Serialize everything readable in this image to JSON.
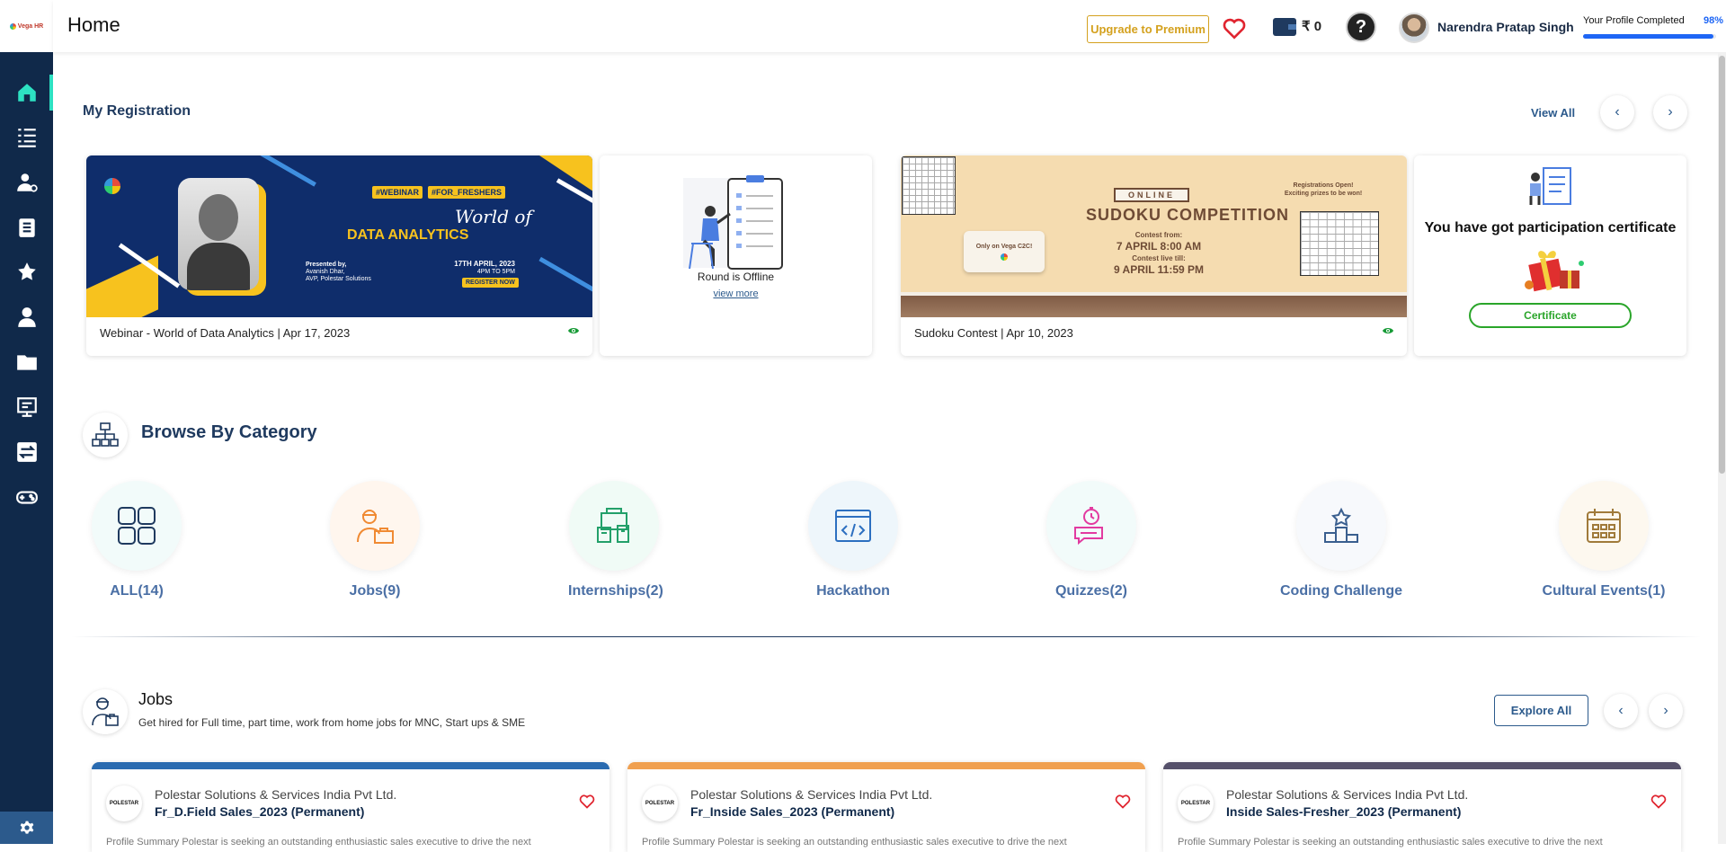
{
  "app": {
    "logo_text": "Vega HR",
    "page_title": "Home"
  },
  "sidebar": {
    "items": [
      {
        "name": "home-icon",
        "active": true
      },
      {
        "name": "list-icon"
      },
      {
        "name": "user-search-icon"
      },
      {
        "name": "clipboard-icon"
      },
      {
        "name": "star-badge-icon"
      },
      {
        "name": "person-icon"
      },
      {
        "name": "folder-icon"
      },
      {
        "name": "monitor-icon"
      },
      {
        "name": "exchange-icon"
      },
      {
        "name": "gamepad-icon"
      }
    ],
    "settings_icon": "gear-icon"
  },
  "topbar": {
    "upgrade_label": "Upgrade to Premium",
    "wallet_amount": "₹ 0",
    "help_label": "?",
    "user_name": "Narendra Pratap Singh",
    "profile_label": "Your Profile Completed",
    "profile_percent": "98%",
    "profile_fraction": 0.98
  },
  "registration": {
    "title": "My Registration",
    "view_all": "View All",
    "webinar": {
      "tags": [
        "#WEBINAR",
        "#FOR_FRESHERS"
      ],
      "headline_1": "World of",
      "headline_2": "DATA ANALYTICS",
      "presented_by": "Presented by,",
      "presenter": "Avanish Dhar,",
      "presenter_role": "AVP, Polestar Solutions",
      "date": "17TH APRIL, 2023",
      "time": "4PM TO 5PM",
      "cta": "REGISTER NOW",
      "caption": "Webinar - World of Data Analytics | Apr 17, 2023"
    },
    "offline": {
      "status": "Round is Offline",
      "link": "view more"
    },
    "sudoku": {
      "badge": "ONLINE",
      "title": "SUDOKU COMPETITION",
      "from_label": "Contest from:",
      "from_value": "7 APRIL 8:00 AM",
      "till_label": "Contest live till:",
      "till_value": "9 APRIL 11:59 PM",
      "promo_1": "Registrations Open!",
      "promo_2": "Exciting prizes to be won!",
      "only_on": "Only on Vega C2C!",
      "caption": "Sudoku Contest | Apr 10, 2023"
    },
    "certificate": {
      "message": "You have got participation certificate",
      "button": "Certificate"
    }
  },
  "categories": {
    "title": "Browse By Category",
    "items": [
      {
        "label": "ALL(14)",
        "icon": "grid-icon",
        "bg": "#f2fbfa"
      },
      {
        "label": "Jobs(9)",
        "icon": "worker-icon",
        "bg": "#fff6ee"
      },
      {
        "label": "Internships(2)",
        "icon": "internship-icon",
        "bg": "#f0fbf6"
      },
      {
        "label": "Hackathon",
        "icon": "code-window-icon",
        "bg": "#eef6fb"
      },
      {
        "label": "Quizzes(2)",
        "icon": "quiz-icon",
        "bg": "#f2fbfa"
      },
      {
        "label": "Coding Challenge",
        "icon": "podium-icon",
        "bg": "#f7f9fc"
      },
      {
        "label": "Cultural Events(1)",
        "icon": "calendar-icon",
        "bg": "#fdf8ef"
      }
    ]
  },
  "jobs": {
    "title": "Jobs",
    "subtitle": "Get hired for Full time, part time, work from home jobs for MNC, Start ups & SME",
    "explore": "Explore All",
    "cards": [
      {
        "company": "Polestar Solutions & Services India Pvt Ltd.",
        "role": "Fr_D.Field Sales_2023 (Permanent)",
        "strip": "#2a6bb0",
        "logo": "POLESTAR",
        "desc": "Profile Summary Polestar is seeking an outstanding enthusiastic sales executive to drive the next"
      },
      {
        "company": "Polestar Solutions & Services India Pvt Ltd.",
        "role": "Fr_Inside Sales_2023 (Permanent)",
        "strip": "#f0a050",
        "logo": "POLESTAR",
        "desc": "Profile Summary Polestar is seeking an outstanding enthusiastic sales executive to drive the next"
      },
      {
        "company": "Polestar Solutions & Services India Pvt Ltd.",
        "role": "Inside Sales-Fresher_2023 (Permanent)",
        "strip": "#55506a",
        "logo": "POLESTAR",
        "desc": "Profile Summary Polestar is seeking an outstanding enthusiastic sales executive to drive the next"
      }
    ]
  }
}
